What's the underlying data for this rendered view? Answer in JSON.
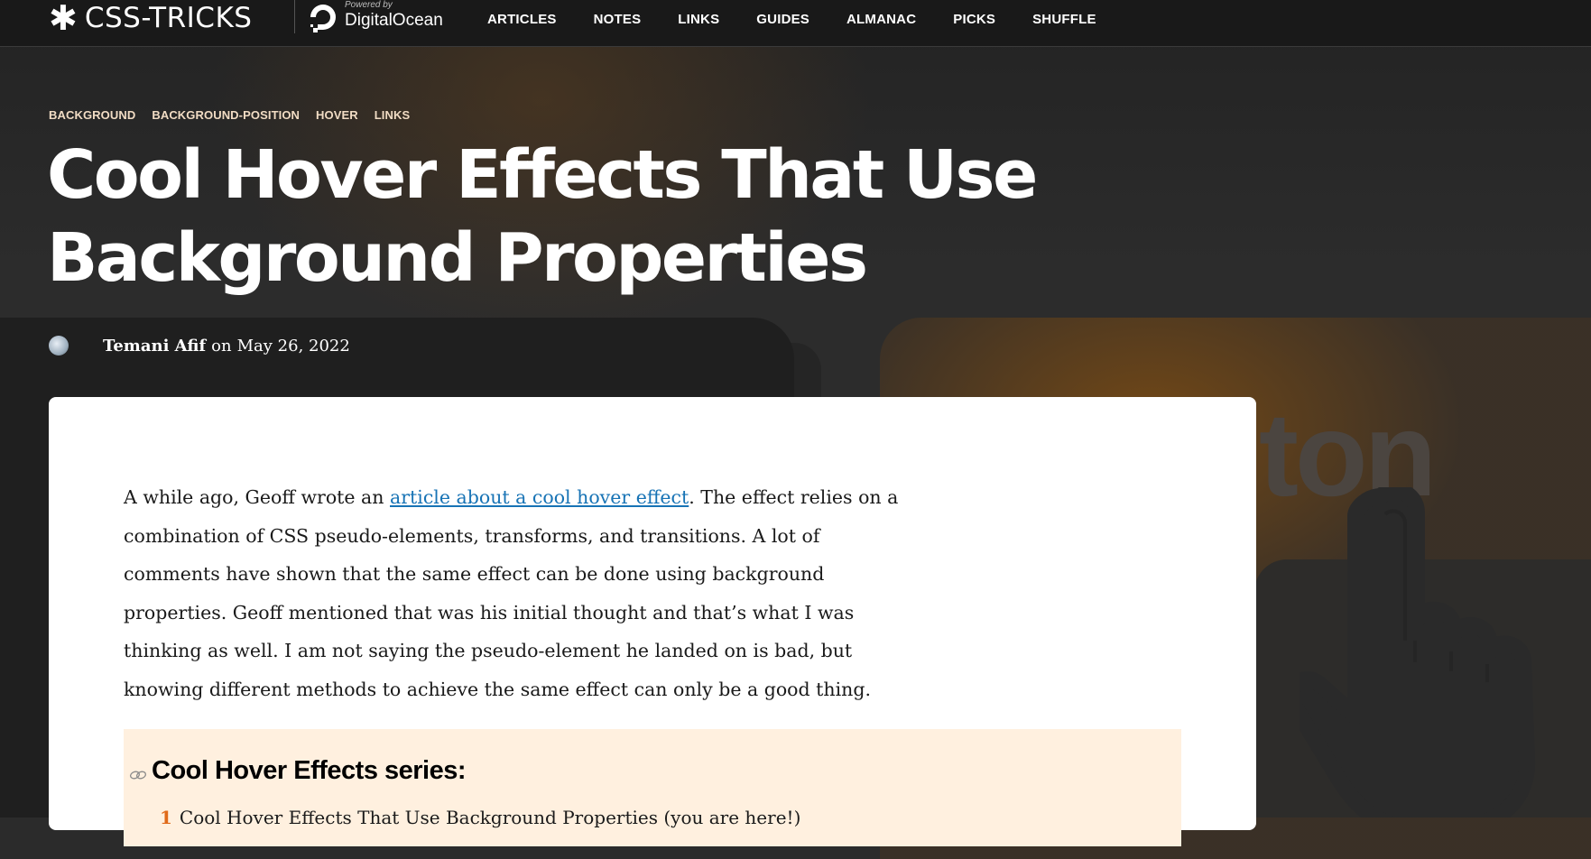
{
  "header": {
    "logo_text": "CSS-TRICKS",
    "sponsor_powered": "Powered by",
    "sponsor_name": "DigitalOcean",
    "nav": [
      {
        "label": "ARTICLES"
      },
      {
        "label": "NOTES"
      },
      {
        "label": "LINKS"
      },
      {
        "label": "GUIDES"
      },
      {
        "label": "ALMANAC"
      },
      {
        "label": "PICKS"
      },
      {
        "label": "SHUFFLE"
      }
    ]
  },
  "hero": {
    "tags": [
      "BACKGROUND",
      "BACKGROUND-POSITION",
      "HOVER",
      "LINKS"
    ],
    "title": "Cool Hover Effects That Use Background Properties",
    "decorative_text": "ton"
  },
  "author": {
    "name": "Temani Afif",
    "connector": "on",
    "date": "May 26, 2022"
  },
  "article": {
    "intro_before_link": "A while ago, Geoff wrote an ",
    "intro_link": "article about a cool hover effect",
    "intro_after_link": ". The effect relies on a combination of CSS pseudo-elements, transforms, and transitions. A lot of comments have shown that the same effect can be done using background properties. Geoff mentioned that was his initial thought and that’s what I was thinking as well. I am not saying the pseudo-element he landed on is bad, but knowing different methods to achieve the same effect can only be a good thing.",
    "series": {
      "heading": "Cool Hover Effects series:",
      "items": [
        {
          "number": "1",
          "text": "Cool Hover Effects That Use Background Properties (you are here!)"
        }
      ]
    }
  },
  "colors": {
    "tag": "#f1dcc4",
    "link": "#1773b5",
    "series_bg": "#fff0df",
    "series_number": "#e06a1a"
  },
  "icons": [
    "asterisk-logo-icon",
    "digitalocean-icon",
    "chain-link-icon",
    "pointer-hand-icon"
  ]
}
